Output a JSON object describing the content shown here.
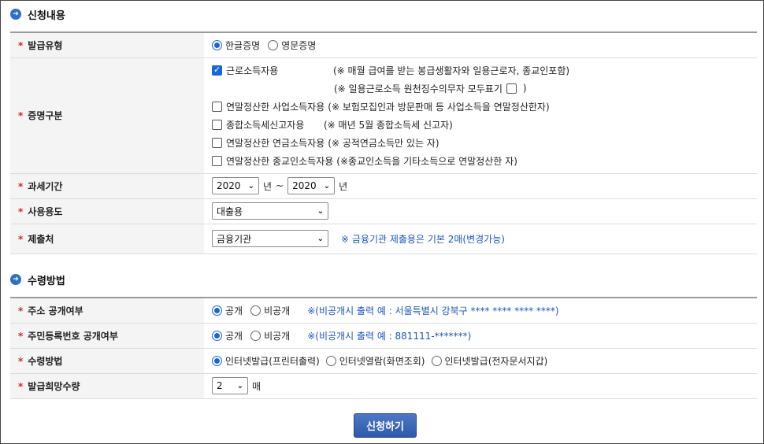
{
  "section1": {
    "title": "신청내용",
    "issue_type": {
      "label": "발급유형",
      "options": [
        "한글증명",
        "영문증명"
      ]
    },
    "cert_type": {
      "label": "증명구분",
      "items": [
        {
          "label": "근로소득자용",
          "note": "(※ 매월 급여를 받는 봉급생활자와 일용근로자, 종교인포함)"
        },
        {
          "label": "연말정산한 사업소득자용",
          "note": "(※ 보험모집인과 방문판매 등 사업소득을 연말정산한자)"
        },
        {
          "label": "종합소득세신고자용",
          "note": "(※ 매년 5월 종합소득세 신고자)"
        },
        {
          "label": "연말정산한 연금소득자용",
          "note": "(※ 공적연금소득만 있는 자)"
        },
        {
          "label": "연말정산한 종교인소득자용",
          "note": "(※종교인소득을 기타소득으로 연말정산한 자)"
        }
      ],
      "sub_note_pre": "(※ 일용근로소득 원천징수의무자 모두표기",
      "sub_note_post": ")"
    },
    "tax_period": {
      "label": "과세기간",
      "from": "2020",
      "to": "2020",
      "unit": "년",
      "sep": "~"
    },
    "usage": {
      "label": "사용용도",
      "value": "대출용"
    },
    "submit_to": {
      "label": "제출처",
      "value": "금융기관",
      "hint": "※ 금융기관 제출용은 기본 2매(변경가능)"
    }
  },
  "section2": {
    "title": "수령방법",
    "address": {
      "label": "주소 공개여부",
      "options": [
        "공개",
        "비공개"
      ],
      "hint": "※(비공개시 출력 예 : 서울특별시 강북구 **** **** **** ****)"
    },
    "rrn": {
      "label": "주민등록번호 공개여부",
      "options": [
        "공개",
        "비공개"
      ],
      "hint": "※(비공개시 출력 예 : 881111-*******)"
    },
    "method": {
      "label": "수령방법",
      "options": [
        "인터넷발급(프린터출력)",
        "인터넷열람(화면조회)",
        "인터넷발급(전자문서지갑)"
      ]
    },
    "qty": {
      "label": "발급희망수량",
      "value": "2",
      "unit": "매"
    }
  },
  "submit_label": "신청하기",
  "star": "*",
  "section_icon": "➜"
}
